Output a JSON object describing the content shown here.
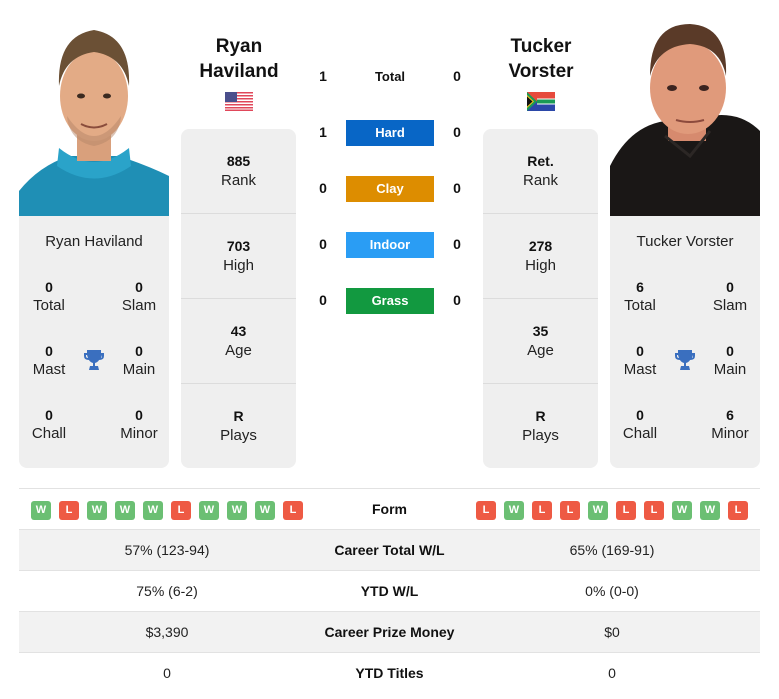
{
  "colors": {
    "win": "#6bbf73",
    "loss": "#ee5a44",
    "hard": "#0866c6",
    "clay": "#dd8d00",
    "indoor": "#2a9df4",
    "grass": "#129940",
    "trophy": "#3a6fbf"
  },
  "players": {
    "left": {
      "name_first": "Ryan",
      "name_last": "Haviland",
      "full_name": "Ryan Haviland",
      "flag": "usa-flag",
      "titles": {
        "total": {
          "value": "0",
          "label": "Total"
        },
        "slam": {
          "value": "0",
          "label": "Slam"
        },
        "mast": {
          "value": "0",
          "label": "Mast"
        },
        "main": {
          "value": "0",
          "label": "Main"
        },
        "chall": {
          "value": "0",
          "label": "Chall"
        },
        "minor": {
          "value": "0",
          "label": "Minor"
        }
      },
      "stats": [
        {
          "value": "885",
          "label": "Rank"
        },
        {
          "value": "703",
          "label": "High"
        },
        {
          "value": "43",
          "label": "Age"
        },
        {
          "value": "R",
          "label": "Plays"
        }
      ],
      "form": [
        "W",
        "L",
        "W",
        "W",
        "W",
        "L",
        "W",
        "W",
        "W",
        "L"
      ]
    },
    "right": {
      "name_first": "Tucker",
      "name_last": "Vorster",
      "full_name": "Tucker Vorster",
      "flag": "south-africa-flag",
      "titles": {
        "total": {
          "value": "6",
          "label": "Total"
        },
        "slam": {
          "value": "0",
          "label": "Slam"
        },
        "mast": {
          "value": "0",
          "label": "Mast"
        },
        "main": {
          "value": "0",
          "label": "Main"
        },
        "chall": {
          "value": "0",
          "label": "Chall"
        },
        "minor": {
          "value": "6",
          "label": "Minor"
        }
      },
      "stats": [
        {
          "value": "Ret.",
          "label": "Rank"
        },
        {
          "value": "278",
          "label": "High"
        },
        {
          "value": "35",
          "label": "Age"
        },
        {
          "value": "R",
          "label": "Plays"
        }
      ],
      "form": [
        "L",
        "W",
        "L",
        "L",
        "W",
        "L",
        "L",
        "W",
        "W",
        "L"
      ]
    }
  },
  "h2h": [
    {
      "label": "Total",
      "left": "1",
      "right": "0",
      "surface": "total"
    },
    {
      "label": "Hard",
      "left": "1",
      "right": "0",
      "surface": "hard"
    },
    {
      "label": "Clay",
      "left": "0",
      "right": "0",
      "surface": "clay"
    },
    {
      "label": "Indoor",
      "left": "0",
      "right": "0",
      "surface": "indoor"
    },
    {
      "label": "Grass",
      "left": "0",
      "right": "0",
      "surface": "grass"
    }
  ],
  "comparison": {
    "form_label": "Form",
    "rows": [
      {
        "label": "Career Total W/L",
        "left": "57% (123-94)",
        "right": "65% (169-91)"
      },
      {
        "label": "YTD W/L",
        "left": "75% (6-2)",
        "right": "0% (0-0)"
      },
      {
        "label": "Career Prize Money",
        "left": "$3,390",
        "right": "$0"
      },
      {
        "label": "YTD Titles",
        "left": "0",
        "right": "0"
      }
    ]
  }
}
